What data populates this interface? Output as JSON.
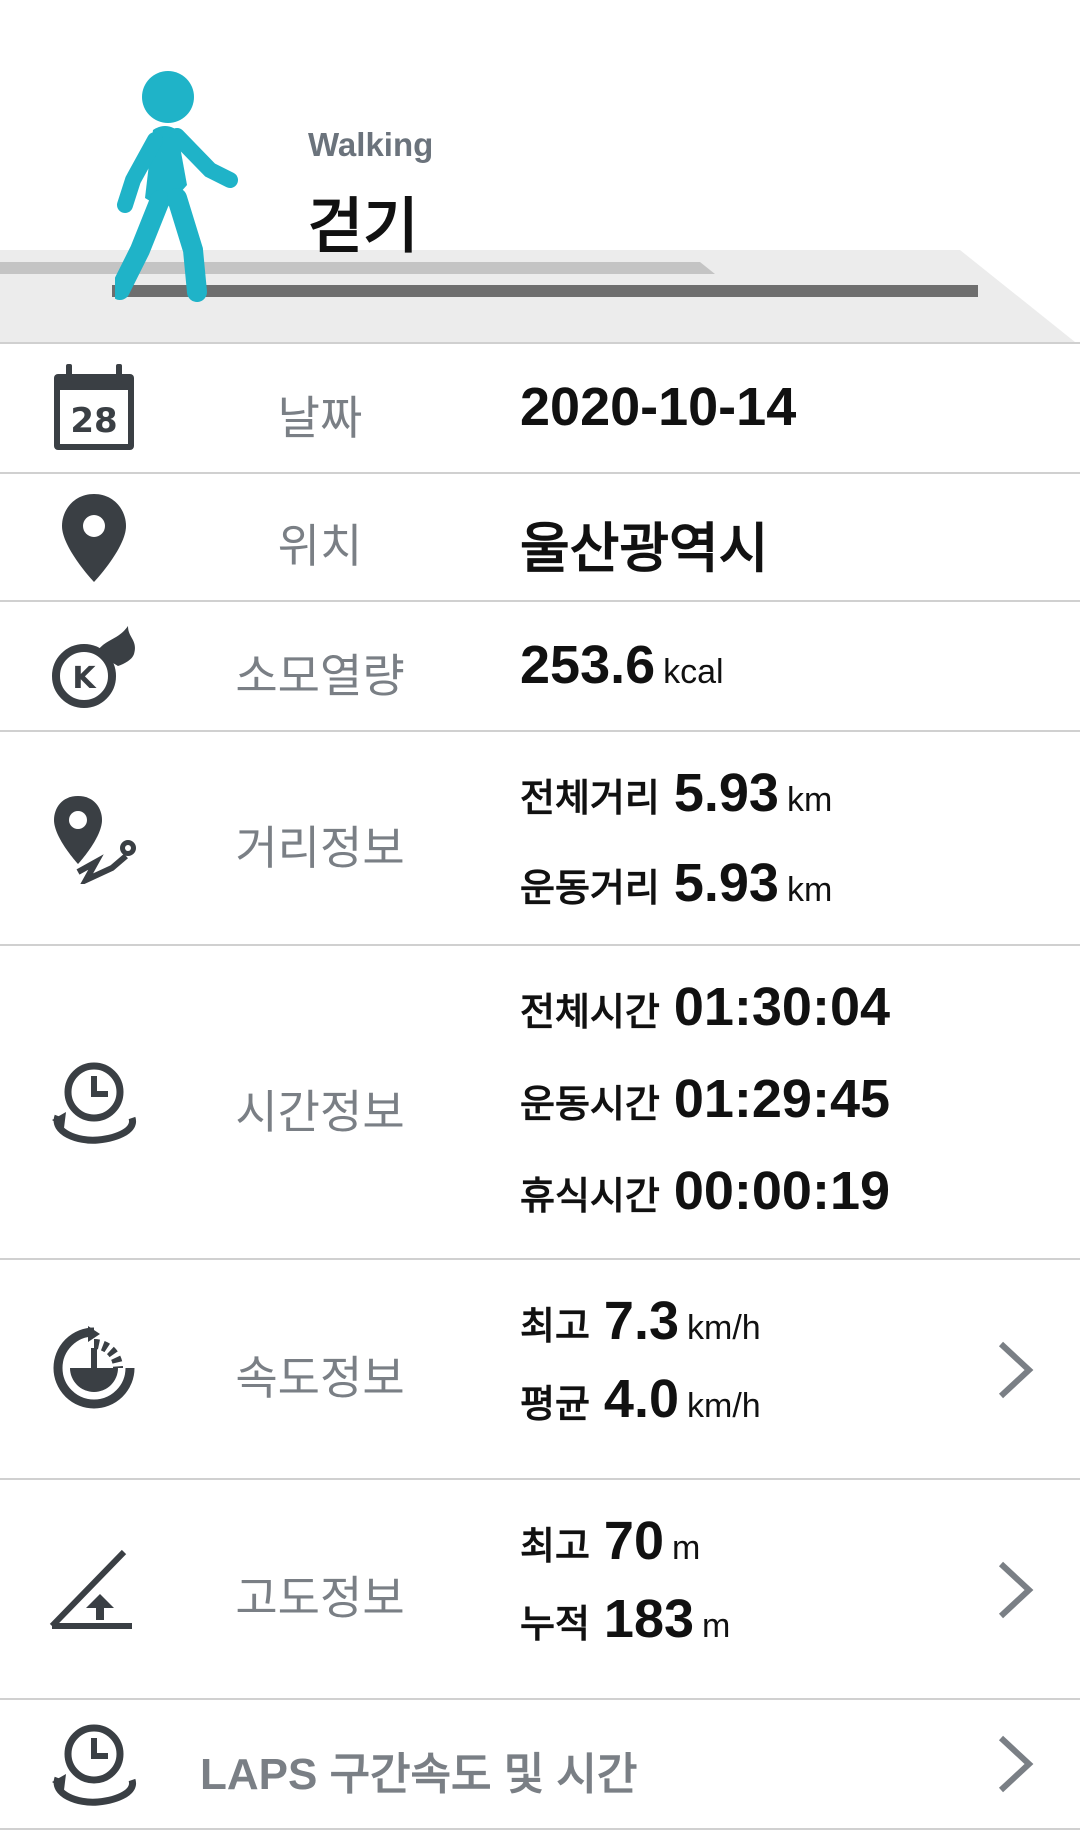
{
  "header": {
    "activity_en": "Walking",
    "activity_ko": "걷기",
    "walker_icon": "walking-person-icon",
    "accent_color": "#1fb3c8"
  },
  "rows": {
    "date": {
      "icon": "calendar-icon",
      "calendar_day": "28",
      "label": "날짜",
      "value": "2020-10-14"
    },
    "location": {
      "icon": "location-pin-icon",
      "label": "위치",
      "value": "울산광역시"
    },
    "calories": {
      "icon": "calorie-fire-icon",
      "label": "소모열량",
      "value": "253.6",
      "unit": "kcal"
    },
    "distance": {
      "icon": "distance-route-icon",
      "label": "거리정보",
      "total_label": "전체거리",
      "total_value": "5.93",
      "total_unit": "km",
      "exercise_label": "운동거리",
      "exercise_value": "5.93",
      "exercise_unit": "km"
    },
    "time": {
      "icon": "clock-cycle-icon",
      "label": "시간정보",
      "total_label": "전체시간",
      "total_value": "01:30:04",
      "exercise_label": "운동시간",
      "exercise_value": "01:29:45",
      "rest_label": "휴식시간",
      "rest_value": "00:00:19"
    },
    "speed": {
      "icon": "speedometer-icon",
      "label": "속도정보",
      "max_label": "최고",
      "max_value": "7.3",
      "max_unit": "km/h",
      "avg_label": "평균",
      "avg_value": "4.0",
      "avg_unit": "km/h"
    },
    "altitude": {
      "icon": "altitude-slope-icon",
      "label": "고도정보",
      "max_label": "최고",
      "max_value": "70",
      "max_unit": "m",
      "cum_label": "누적",
      "cum_value": "183",
      "cum_unit": "m"
    },
    "laps": {
      "icon": "laps-clock-icon",
      "label": "LAPS 구간속도 및 시간"
    }
  }
}
